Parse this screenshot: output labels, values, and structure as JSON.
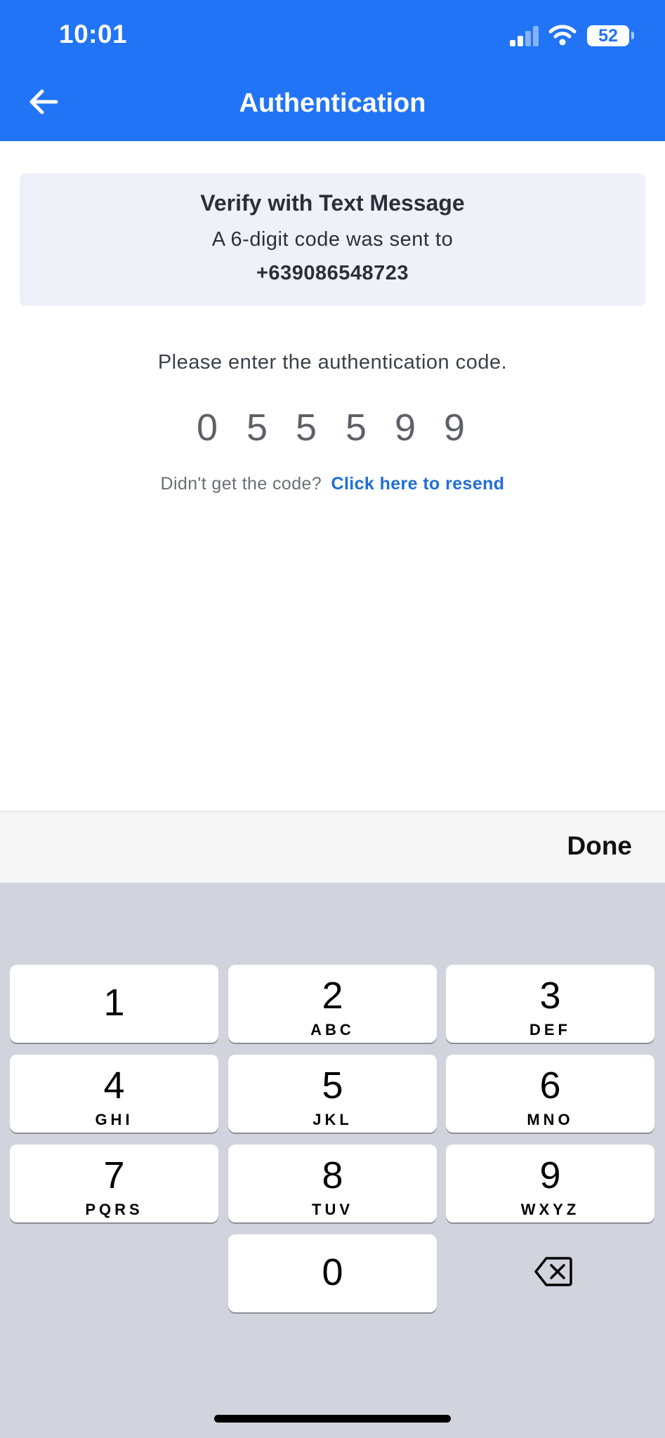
{
  "status_bar": {
    "time": "10:01",
    "battery": "52",
    "icons": [
      "cellular-signal-icon",
      "wifi-icon",
      "battery-icon"
    ]
  },
  "header": {
    "title": "Authentication",
    "back_icon": "arrow-left-icon",
    "background_color": "#2174f5"
  },
  "verify_card": {
    "title": "Verify with Text Message",
    "subtitle": "A 6-digit code was sent to",
    "phone": "+639086548723"
  },
  "prompt": "Please enter the authentication code.",
  "code_digits": [
    "0",
    "5",
    "5",
    "5",
    "9",
    "9"
  ],
  "resend": {
    "question": "Didn't get the code?",
    "link": "Click here to resend",
    "link_color": "#1e6fd6"
  },
  "keyboard": {
    "done_label": "Done",
    "keys": [
      {
        "num": "1",
        "letters": ""
      },
      {
        "num": "2",
        "letters": "ABC"
      },
      {
        "num": "3",
        "letters": "DEF"
      },
      {
        "num": "4",
        "letters": "GHI"
      },
      {
        "num": "5",
        "letters": "JKL"
      },
      {
        "num": "6",
        "letters": "MNO"
      },
      {
        "num": "7",
        "letters": "PQRS"
      },
      {
        "num": "8",
        "letters": "TUV"
      },
      {
        "num": "9",
        "letters": "WXYZ"
      },
      {
        "num": "0",
        "letters": ""
      }
    ],
    "delete_icon": "backspace-icon"
  }
}
